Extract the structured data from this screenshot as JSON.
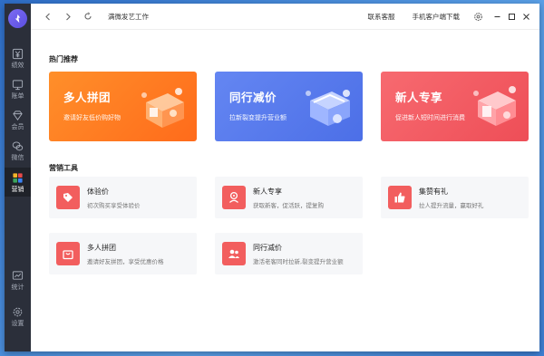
{
  "window": {
    "title": "满微发艺工作"
  },
  "titlebar": {
    "contact": "联系客服",
    "download": "手机客户端下载"
  },
  "sidebar": {
    "items": [
      {
        "label": "绩效",
        "icon": "yuan-icon"
      },
      {
        "label": "账单",
        "icon": "monitor-icon"
      },
      {
        "label": "会员",
        "icon": "diamond-icon"
      },
      {
        "label": "微信",
        "icon": "wechat-icon"
      },
      {
        "label": "营销",
        "icon": "apps-icon"
      },
      {
        "label": "统计",
        "icon": "chart-icon"
      },
      {
        "label": "设置",
        "icon": "gear-icon"
      }
    ],
    "active": "营销"
  },
  "hot": {
    "title": "热门推荐",
    "banners": [
      {
        "title": "多人拼团",
        "subtitle": "邀请好友低价购好物",
        "color_start": "#ff8a26",
        "color_end": "#ff6a1a"
      },
      {
        "title": "同行减价",
        "subtitle": "拉新裂变提升营业额",
        "color_start": "#5b7df0",
        "color_end": "#4a6de6"
      },
      {
        "title": "新人专享",
        "subtitle": "促进新人短时间进行消费",
        "color_start": "#f5646a",
        "color_end": "#ef4f57"
      }
    ]
  },
  "tools": {
    "title": "营销工具",
    "items": [
      {
        "title": "体验价",
        "desc": "初次购买享受体验价",
        "icon": "tag-icon"
      },
      {
        "title": "新人专享",
        "desc": "获取新客，促活跃，提复购",
        "icon": "newcomer-icon"
      },
      {
        "title": "集赞有礼",
        "desc": "拉人提升流量，赢取好礼",
        "icon": "thumbs-up-icon"
      },
      {
        "title": "多人拼团",
        "desc": "邀请好友拼团，享受优惠价格",
        "icon": "bag-icon"
      },
      {
        "title": "同行减价",
        "desc": "激活老客同时拉新,裂变提升营业额",
        "icon": "people-icon"
      }
    ]
  },
  "colors": {
    "sidebar": "#2b2f3a",
    "accent": "#f25e5e"
  }
}
